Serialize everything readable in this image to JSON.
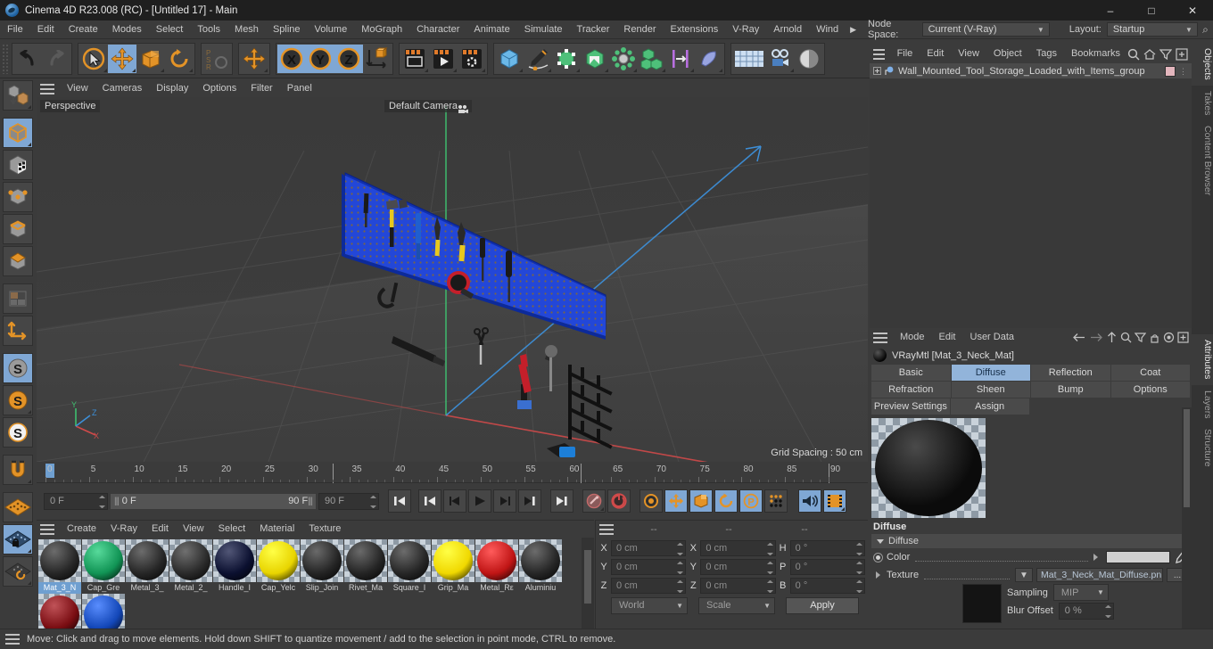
{
  "window": {
    "title": "Cinema 4D R23.008 (RC) - [Untitled 17] - Main",
    "minimize": "–",
    "maximize": "□",
    "close": "✕"
  },
  "menubar": {
    "items": [
      "File",
      "Edit",
      "Create",
      "Modes",
      "Select",
      "Tools",
      "Mesh",
      "Spline",
      "Volume",
      "MoGraph",
      "Character",
      "Animate",
      "Simulate",
      "Tracker",
      "Render",
      "Extensions",
      "V-Ray",
      "Arnold",
      "Wind"
    ],
    "overflow_arrow": "▶",
    "node_space_label": "Node Space:",
    "node_space_value": "Current (V-Ray)",
    "layout_label": "Layout:",
    "layout_value": "Startup",
    "search_icon": "⌕"
  },
  "viewport": {
    "menu": [
      "View",
      "Cameras",
      "Display",
      "Options",
      "Filter",
      "Panel"
    ],
    "perspective_label": "Perspective",
    "camera_label": "Default Camera",
    "grid_spacing": "Grid Spacing : 50 cm",
    "axis_x": "X",
    "axis_y": "Y",
    "axis_z": "Z"
  },
  "timeline": {
    "ticks": [
      "0",
      "5",
      "10",
      "15",
      "20",
      "25",
      "30",
      "35",
      "40",
      "45",
      "50",
      "55",
      "60",
      "65",
      "70",
      "75",
      "80",
      "85",
      "90"
    ],
    "current_frame": "0 F",
    "range_start": "0 F",
    "range_end": "90 F",
    "end_frame": "90 F",
    "frame_field_right": "0 F"
  },
  "materials": {
    "menu": [
      "Create",
      "V-Ray",
      "Edit",
      "View",
      "Select",
      "Material",
      "Texture"
    ],
    "items": [
      {
        "name": "Mat_3_N",
        "color": "#262626",
        "selected": true
      },
      {
        "name": "Cap_Gre",
        "color": "#119455",
        "selected": false
      },
      {
        "name": "Metal_3_",
        "color": "#262626",
        "selected": false
      },
      {
        "name": "Metal_2_",
        "color": "#2a2a2a",
        "selected": false
      },
      {
        "name": "Handle_I",
        "color": "#0b1030",
        "selected": false
      },
      {
        "name": "Cap_Yelc",
        "color": "#e8d400",
        "selected": false
      },
      {
        "name": "Slip_Join",
        "color": "#242424",
        "selected": false
      },
      {
        "name": "Rivet_Ma",
        "color": "#242424",
        "selected": false
      },
      {
        "name": "Square_I",
        "color": "#262626",
        "selected": false
      },
      {
        "name": "Grip_Ma",
        "color": "#f0d800",
        "selected": false
      },
      {
        "name": "Metal_Rε",
        "color": "#c01515",
        "selected": false
      },
      {
        "name": "Aluminiu",
        "color": "#262626",
        "selected": false
      },
      {
        "name": "",
        "color": "#7a0d12",
        "selected": false
      },
      {
        "name": "",
        "color": "#1347b8",
        "selected": false
      }
    ]
  },
  "coordinates": {
    "header": [
      "--",
      "--",
      "--"
    ],
    "rows": [
      {
        "l1": "X",
        "v1": "0 cm",
        "l2": "X",
        "v2": "0 cm",
        "l3": "H",
        "v3": "0 °"
      },
      {
        "l1": "Y",
        "v1": "0 cm",
        "l2": "Y",
        "v2": "0 cm",
        "l3": "P",
        "v3": "0 °"
      },
      {
        "l1": "Z",
        "v1": "0 cm",
        "l2": "Z",
        "v2": "0 cm",
        "l3": "B",
        "v3": "0 °"
      }
    ],
    "system": "World",
    "mode": "Scale",
    "apply": "Apply"
  },
  "objects": {
    "menu": [
      "File",
      "Edit",
      "View",
      "Object",
      "Tags",
      "Bookmarks"
    ],
    "root_item": "Wall_Mounted_Tool_Storage_Loaded_with_Items_group"
  },
  "attributes": {
    "menu": [
      "Mode",
      "Edit",
      "User Data"
    ],
    "title": "VRayMtl [Mat_3_Neck_Mat]",
    "tabs_row1": [
      "Basic",
      "Diffuse",
      "Reflection",
      "Coat"
    ],
    "tabs_row2": [
      "Refraction",
      "Sheen",
      "Bump",
      "Options"
    ],
    "tabs_row3": [
      "Preview Settings",
      "Assign"
    ],
    "active_tab": "Diffuse",
    "section_title": "Diffuse",
    "group_label": "Diffuse",
    "color_label": "Color",
    "color_value": "#d0d0d0",
    "texture_label": "Texture",
    "texture_value": "Mat_3_Neck_Mat_Diffuse.pn",
    "texture_browse": "...",
    "sampling_label": "Sampling",
    "sampling_value": "MIP",
    "blur_label": "Blur Offset",
    "blur_value": "0 %"
  },
  "right_tabs": {
    "top": [
      "Objects",
      "Takes",
      "Content Browser"
    ],
    "bottom": [
      "Attributes",
      "Layers",
      "Structure"
    ]
  },
  "status": {
    "text": "Move: Click and drag to move elements. Hold down SHIFT to quantize movement / add to the selection in point mode, CTRL to remove."
  },
  "colors": {
    "accent_blue": "#7fa7d4",
    "orange": "#e08a2a",
    "panel_bg": "#3b3b3b",
    "board_blue": "#1f3fc8"
  }
}
